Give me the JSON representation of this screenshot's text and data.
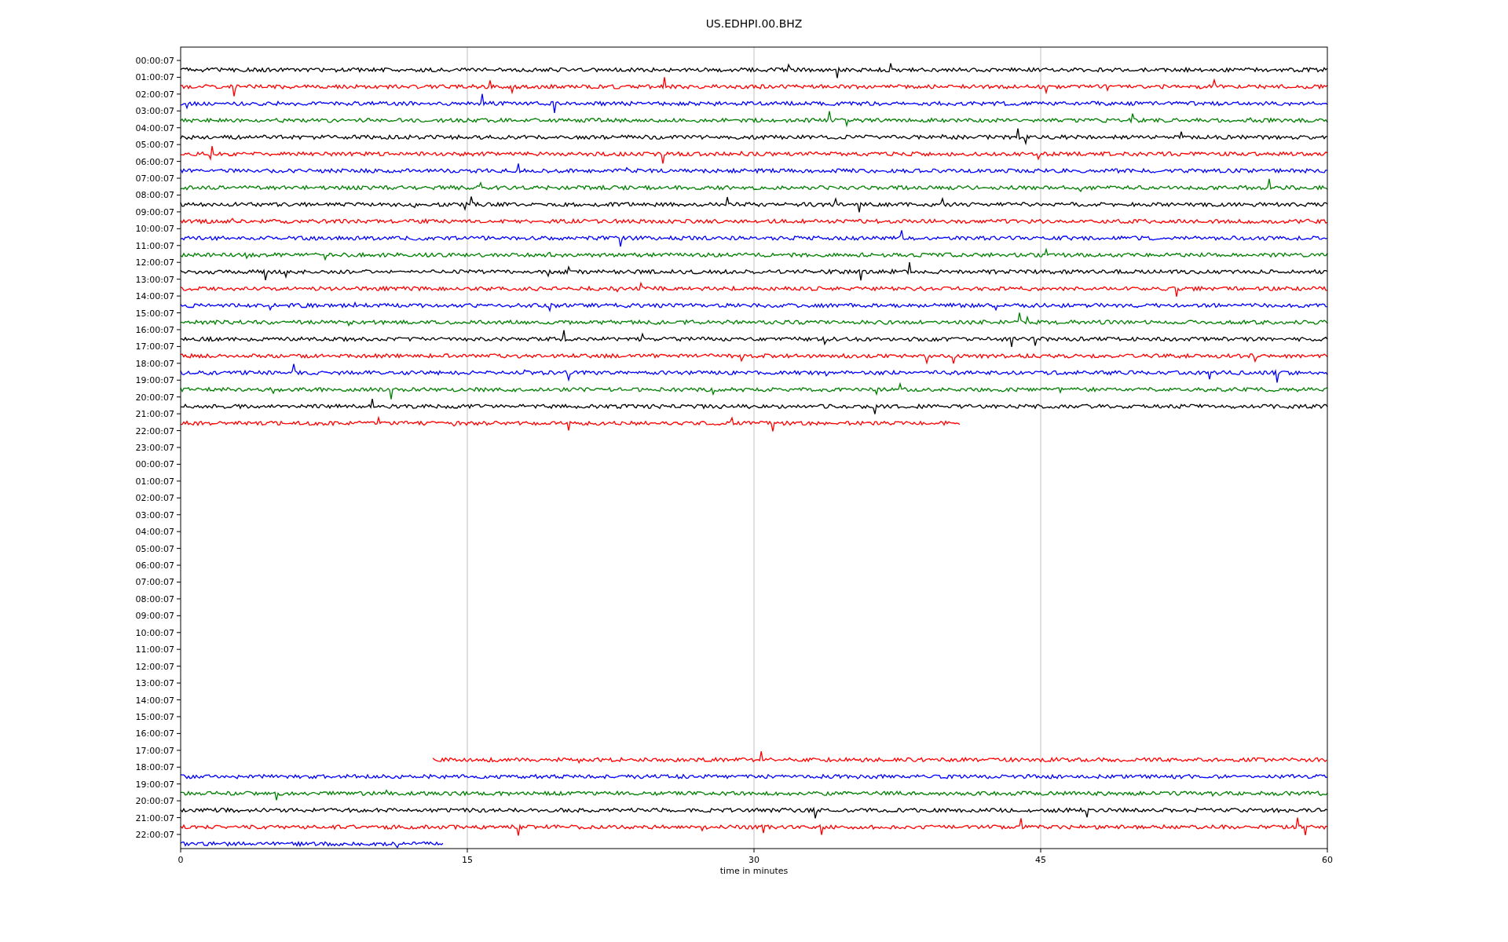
{
  "title": "US.EDHPI.00.BHZ",
  "x_axis": {
    "label": "time in minutes",
    "ticks": [
      "0",
      "15",
      "30",
      "45",
      "60"
    ]
  },
  "rows": [
    {
      "label": "00:00:07",
      "trace": {
        "color": "#000000",
        "level": 1
      }
    },
    {
      "label": "01:00:07",
      "trace": {
        "color": "#ff0000",
        "level": 1
      }
    },
    {
      "label": "02:00:07",
      "trace": {
        "color": "#0000ff",
        "level": 1
      }
    },
    {
      "label": "03:00:07",
      "trace": {
        "color": "#008000",
        "level": 1
      }
    },
    {
      "label": "04:00:07",
      "trace": {
        "color": "#000000",
        "level": 1
      }
    },
    {
      "label": "05:00:07",
      "trace": {
        "color": "#ff0000",
        "level": 1
      }
    },
    {
      "label": "06:00:07",
      "trace": {
        "color": "#0000ff",
        "level": 1
      }
    },
    {
      "label": "07:00:07",
      "trace": {
        "color": "#008000",
        "level": 1
      }
    },
    {
      "label": "08:00:07",
      "trace": {
        "color": "#000000",
        "level": 1
      }
    },
    {
      "label": "09:00:07",
      "trace": {
        "color": "#ff0000",
        "level": 1
      }
    },
    {
      "label": "10:00:07",
      "trace": {
        "color": "#0000ff",
        "level": 1
      }
    },
    {
      "label": "11:00:07",
      "trace": {
        "color": "#008000",
        "level": 1
      }
    },
    {
      "label": "12:00:07",
      "trace": {
        "color": "#000000",
        "level": 1
      }
    },
    {
      "label": "13:00:07",
      "trace": {
        "color": "#ff0000",
        "level": 1
      }
    },
    {
      "label": "14:00:07",
      "trace": {
        "color": "#0000ff",
        "level": 1
      }
    },
    {
      "label": "15:00:07",
      "trace": {
        "color": "#008000",
        "level": 1
      }
    },
    {
      "label": "16:00:07",
      "trace": {
        "color": "#000000",
        "level": 1
      }
    },
    {
      "label": "17:00:07",
      "trace": {
        "color": "#ff0000",
        "level": 1
      }
    },
    {
      "label": "18:00:07",
      "trace": {
        "color": "#0000ff",
        "level": 1
      }
    },
    {
      "label": "19:00:07",
      "trace": {
        "color": "#008000",
        "level": 1
      }
    },
    {
      "label": "20:00:07",
      "trace": {
        "color": "#000000",
        "level": 1
      }
    },
    {
      "label": "21:00:07",
      "trace": {
        "color": "#ff0000",
        "level": 0.68,
        "late_start": false
      }
    },
    {
      "label": "22:00:07"
    },
    {
      "label": "23:00:07"
    },
    {
      "label": "00:00:07"
    },
    {
      "label": "01:00:07"
    },
    {
      "label": "02:00:07"
    },
    {
      "label": "03:00:07"
    },
    {
      "label": "04:00:07"
    },
    {
      "label": "05:00:07"
    },
    {
      "label": "06:00:07"
    },
    {
      "label": "07:00:07"
    },
    {
      "label": "08:00:07"
    },
    {
      "label": "09:00:07"
    },
    {
      "label": "10:00:07"
    },
    {
      "label": "11:00:07"
    },
    {
      "label": "12:00:07"
    },
    {
      "label": "13:00:07"
    },
    {
      "label": "14:00:07"
    },
    {
      "label": "15:00:07"
    },
    {
      "label": "16:00:07"
    },
    {
      "label": "17:00:07",
      "trace": {
        "color": "#ff0000",
        "level": 0.78,
        "late_start": true
      }
    },
    {
      "label": "18:00:07",
      "trace": {
        "color": "#0000ff",
        "level": 1
      }
    },
    {
      "label": "19:00:07",
      "trace": {
        "color": "#008000",
        "level": 1
      }
    },
    {
      "label": "20:00:07",
      "trace": {
        "color": "#000000",
        "level": 1
      }
    },
    {
      "label": "21:00:07",
      "trace": {
        "color": "#ff0000",
        "level": 1
      }
    },
    {
      "label": "22:00:07",
      "trace": {
        "color": "#0000ff",
        "level": 0.23,
        "late_start": false
      }
    }
  ]
}
